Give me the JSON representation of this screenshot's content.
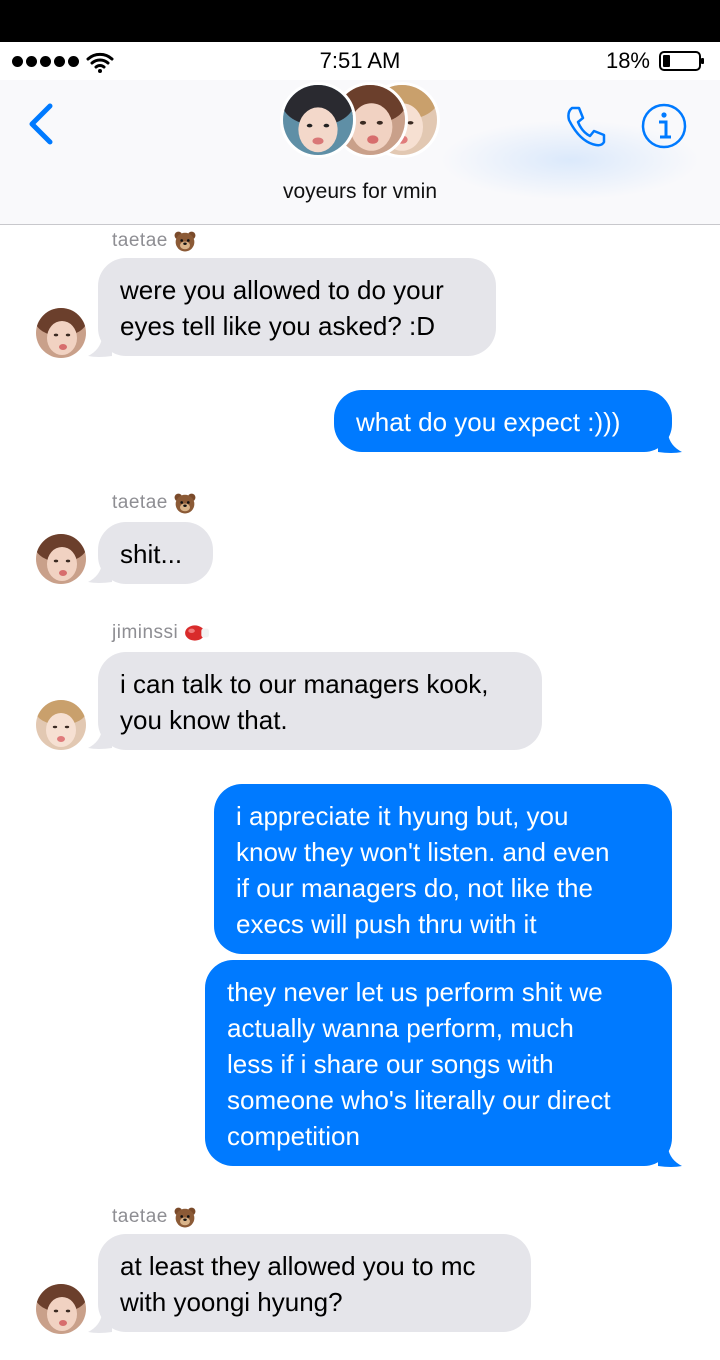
{
  "status": {
    "time": "7:51 AM",
    "battery": "18%"
  },
  "header": {
    "group_name": "voyeurs for vmin"
  },
  "messages": [
    {
      "sender": "taetae",
      "sender_emoji": "bear-emoji",
      "lines": [
        "were you allowed to do your",
        "eyes tell like you asked? :D"
      ]
    },
    {
      "lines": [
        "what do you expect :)))"
      ]
    },
    {
      "sender": "taetae",
      "sender_emoji": "bear-emoji",
      "lines": [
        "shit..."
      ]
    },
    {
      "sender": "jiminssi",
      "sender_emoji": "boxing-glove-emoji",
      "lines": [
        "i can talk to our managers kook,",
        "you know that."
      ]
    },
    {
      "lines": [
        "i appreciate it hyung but, you",
        "know they won't listen. and even",
        "if our managers do, not like the",
        "execs will push thru with it"
      ]
    },
    {
      "lines": [
        "they never let us perform shit we",
        "actually wanna perform, much",
        "less if i share our songs with",
        "someone who's literally our direct",
        "competition"
      ]
    },
    {
      "sender": "taetae",
      "sender_emoji": "bear-emoji",
      "lines": [
        "at least they allowed you to mc",
        "with yoongi hyung?"
      ]
    }
  ],
  "colors": {
    "outgoing": "#007aff",
    "incoming": "#e5e5ea",
    "accent": "#007aff"
  }
}
